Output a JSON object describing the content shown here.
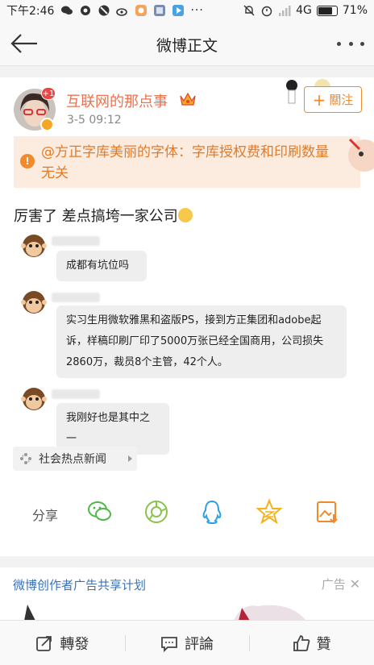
{
  "status_bar": {
    "time": "下午2:46",
    "network": "4G",
    "battery": "71%",
    "battery_level": 0.71
  },
  "header": {
    "title": "微博正文"
  },
  "post": {
    "username": "互联网的那点事",
    "time": "3-5 09:12",
    "avatar_badge": "+1",
    "follow_label": "關注",
    "notice_text": "@方正字库美丽的字体：字库授权费和印刷数量无关",
    "text": "厉害了 差点搞垮一家公司",
    "comments": [
      {
        "text": "成都有坑位吗"
      },
      {
        "text": "实习生用微软雅黑和盗版PS，接到方正集团和adobe起诉，样稿印刷厂印了5000万张已经全国商用，公司损失2860万，裁员8个主管，42个人。"
      },
      {
        "text": "我刚好也是其中之一"
      }
    ],
    "topic": "社会热点新闻"
  },
  "share": {
    "label": "分享",
    "icons": [
      "wechat-icon",
      "moments-icon",
      "qq-icon",
      "qzone-icon",
      "save-image-icon"
    ]
  },
  "ad": {
    "title": "微博创作者广告共享计划",
    "label": "广告"
  },
  "bottom_bar": {
    "repost": "轉發",
    "comment": "評論",
    "like": "贊"
  },
  "colors": {
    "accent_orange": "#f08a2c",
    "username": "#eb7350",
    "link_blue": "#3b73b9"
  }
}
